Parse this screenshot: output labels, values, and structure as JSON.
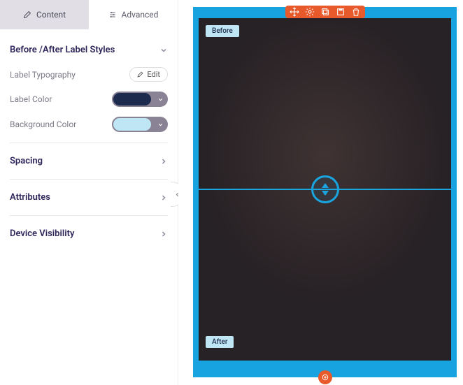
{
  "sidebar": {
    "tabs": {
      "content": "Content",
      "advanced": "Advanced"
    },
    "active_tab": "content",
    "section_labels": {
      "label": "Before /After Label Styles",
      "expanded": true
    },
    "rows": {
      "typography_label": "Label Typography",
      "typography_edit": "Edit",
      "label_color": "Label Color",
      "label_color_value": "#1d2b4f",
      "background_color": "Background Color",
      "background_color_value": "#bfe6f5"
    },
    "collapsed_sections": {
      "spacing": "Spacing",
      "attributes": "Attributes",
      "device_visibility": "Device Visibility"
    }
  },
  "canvas": {
    "frame_color": "#17a2e0",
    "widget": {
      "before_label": "Before",
      "after_label": "After",
      "slider_position_pct": 50
    }
  }
}
